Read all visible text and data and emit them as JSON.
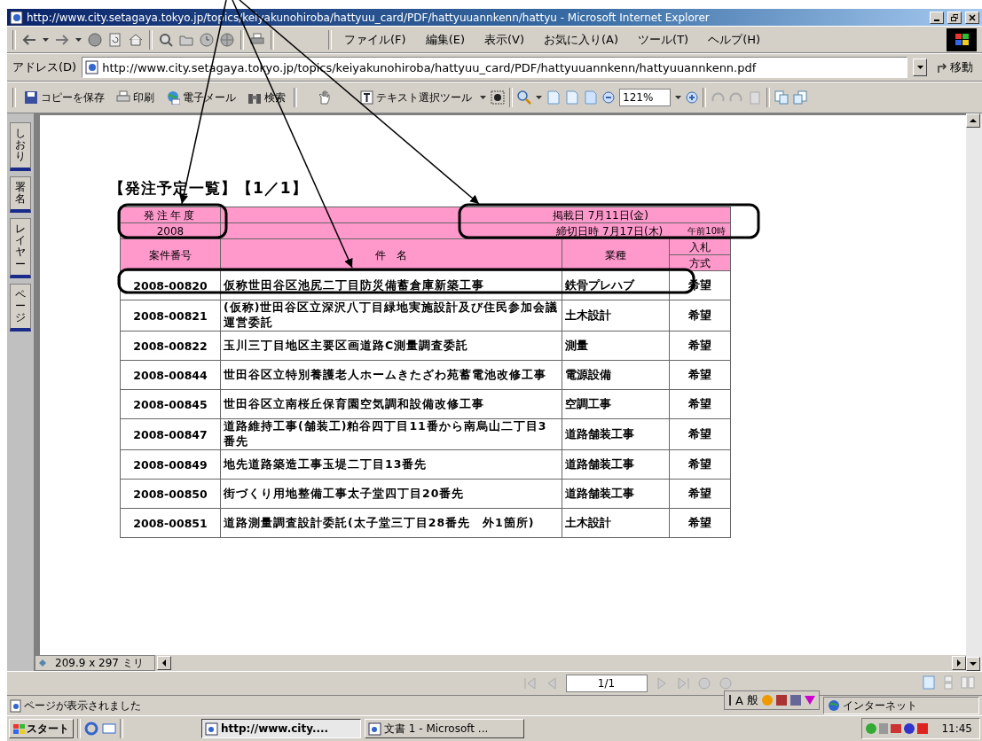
{
  "window": {
    "title": "http://www.city.setagaya.tokyo.jp/topics/keiyakunohiroba/hattyuu_card/PDF/hattyuuannkenn/hattyu - Microsoft Internet Explorer"
  },
  "menu": [
    "ファイル(F)",
    "編集(E)",
    "表示(V)",
    "お気に入り(A)",
    "ツール(T)",
    "ヘルプ(H)"
  ],
  "address_bar": {
    "label": "アドレス(D)",
    "url": "http://www.city.setagaya.tokyo.jp/topics/keiyakunohiroba/hattyuu_card/PDF/hattyuuannkenn/hattyuuannkenn.pdf",
    "go_button": "移動"
  },
  "pdf_toolbar": {
    "save_copy": "コピーを保存",
    "print": "印刷",
    "email": "電子メール",
    "search": "検索",
    "select_tool": "テキスト選択ツール",
    "zoom": "121%"
  },
  "side_tabs": [
    {
      "label": "しおり"
    },
    {
      "label": "署名"
    },
    {
      "label": "レイヤー"
    },
    {
      "label": "ページ"
    }
  ],
  "document": {
    "heading": "【発注予定一覧】【1／1】",
    "fiscal_year_label": "発注年度",
    "fiscal_year": "2008",
    "posting_date": "掲載日 7月11日(金)",
    "deadline": "締切日時 7月17日(木)",
    "deadline_time": "午前10時",
    "columns": [
      "案件番号",
      "件　名",
      "業種"
    ],
    "bid_column": [
      "入札",
      "方式"
    ],
    "rows": [
      {
        "number": "2008-00820",
        "name": "仮称世田谷区池尻二丁目防災備蓄倉庫新築工事",
        "category": "鉄骨プレハブ",
        "method": "希望"
      },
      {
        "number": "2008-00821",
        "name": "(仮称)世田谷区立深沢八丁目緑地実施設計及び住民参加会議運営委託",
        "category": "土木設計",
        "method": "希望"
      },
      {
        "number": "2008-00822",
        "name": "玉川三丁目地区主要区画道路C測量調査委託",
        "category": "測量",
        "method": "希望"
      },
      {
        "number": "2008-00844",
        "name": "世田谷区立特別養護老人ホームきたざわ苑蓄電池改修工事",
        "category": "電源設備",
        "method": "希望"
      },
      {
        "number": "2008-00845",
        "name": "世田谷区立南桜丘保育園空気調和設備改修工事",
        "category": "空調工事",
        "method": "希望"
      },
      {
        "number": "2008-00847",
        "name": "道路維持工事(舗装工)粕谷四丁目11番から南烏山二丁目3番先",
        "category": "道路舗装工事",
        "method": "希望"
      },
      {
        "number": "2008-00849",
        "name": "地先道路築造工事玉堤二丁目13番先",
        "category": "道路舗装工事",
        "method": "希望"
      },
      {
        "number": "2008-00850",
        "name": "街づくり用地整備工事太子堂四丁目20番先",
        "category": "道路舗装工事",
        "method": "希望"
      },
      {
        "number": "2008-00851",
        "name": "道路測量調査設計委託(太子堂三丁目28番先　外1箇所)",
        "category": "土木設計",
        "method": "希望"
      }
    ]
  },
  "page_size": "209.9 x 297 ミリ",
  "page_nav": "1/1",
  "status_bar": {
    "text": "ページが表示されました",
    "ime": [
      "A",
      "般"
    ],
    "zone": "インターネット"
  },
  "taskbar": {
    "start": "スタート",
    "tasks": [
      {
        "label": "http://www.city....",
        "selected": true
      },
      {
        "label": "文書 1 - Microsoft ...",
        "selected": false
      }
    ],
    "clock": "11:45"
  }
}
